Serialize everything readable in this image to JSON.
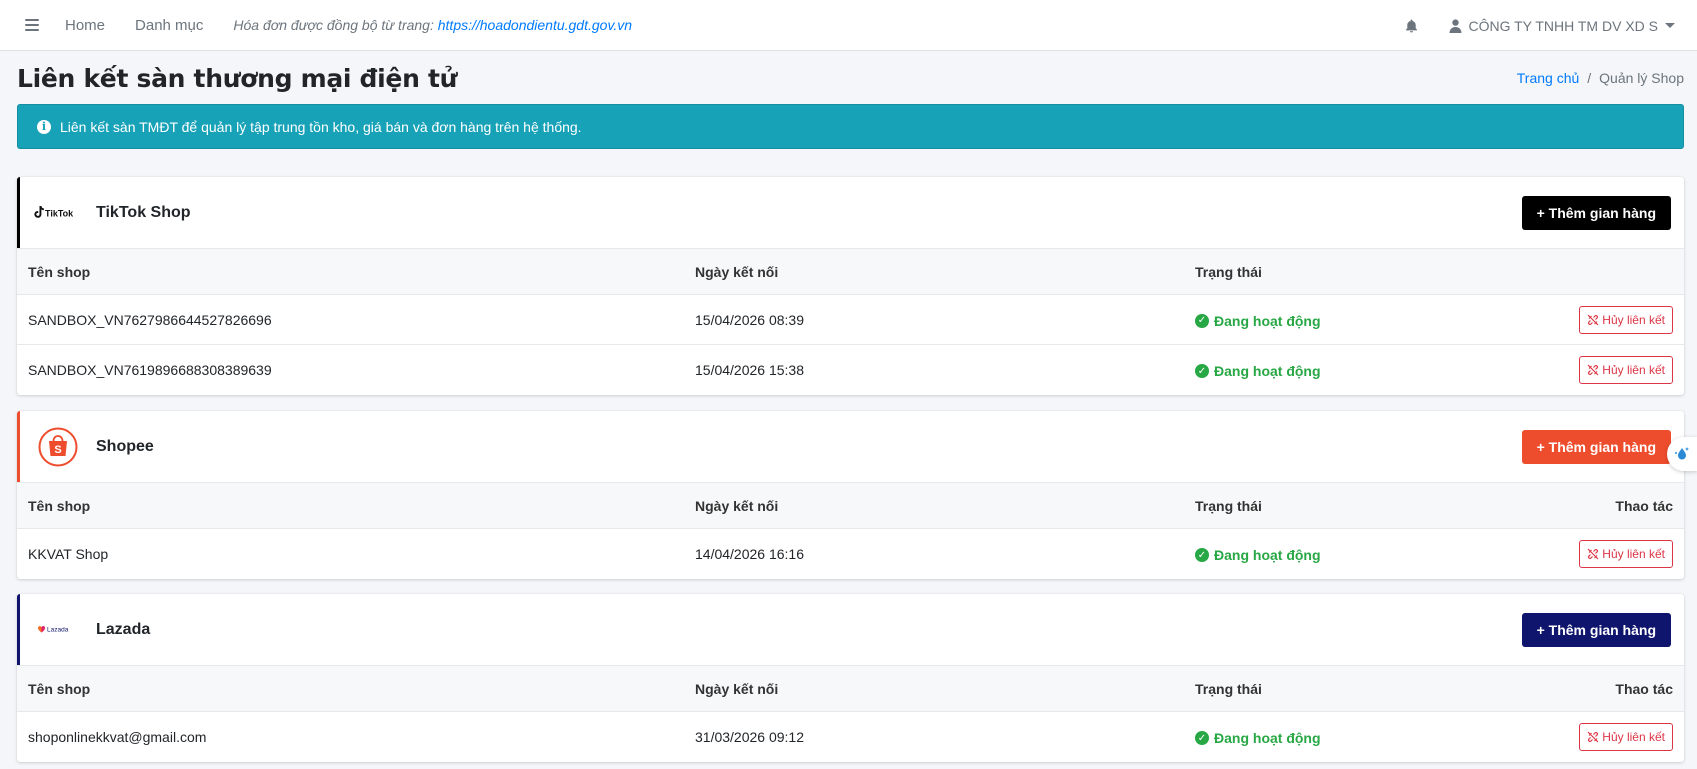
{
  "topbar": {
    "nav_home": "Home",
    "nav_category": "Danh mục",
    "sync_text": "Hóa đơn được đồng bộ từ trang:",
    "sync_link": "https://hoadondientu.gdt.gov.vn",
    "user_name": "CÔNG TY TNHH TM DV XD S"
  },
  "page": {
    "title": "Liên kết sàn thương mại điện tử",
    "breadcrumb_home": "Trang chủ",
    "breadcrumb_sep": "/",
    "breadcrumb_current": "Quản lý Shop"
  },
  "alert": {
    "text": "Liên kết sàn TMĐT để quản lý tập trung tồn kho, giá bán và đơn hàng trên hệ thống."
  },
  "columns": {
    "shop_name": "Tên shop",
    "connect_date": "Ngày kết nối",
    "status": "Trạng thái",
    "actions": "Thao tác"
  },
  "platforms": [
    {
      "name": "TikTok Shop",
      "logo_text": "TikTok",
      "accent": "#000000",
      "add_label": "+ Thêm gian hàng",
      "actions_header": "",
      "shops": [
        {
          "name": "SANDBOX_VN7627986644527826696",
          "date": "15/04/2026 08:39",
          "status": "Đang hoạt động",
          "action": "Hủy liên kết"
        },
        {
          "name": "SANDBOX_VN7619896688308389639",
          "date": "15/04/2026 15:38",
          "status": "Đang hoạt động",
          "action": "Hủy liên kết"
        }
      ]
    },
    {
      "name": "Shopee",
      "logo_text": "S",
      "accent": "#ee4d2d",
      "add_label": "+ Thêm gian hàng",
      "actions_header": "Thao tác",
      "shops": [
        {
          "name": "KKVAT Shop",
          "date": "14/04/2026 16:16",
          "status": "Đang hoạt động",
          "action": "Hủy liên kết"
        }
      ]
    },
    {
      "name": "Lazada",
      "logo_text": "Lazada",
      "accent": "#0f146d",
      "add_label": "+ Thêm gian hàng",
      "actions_header": "Thao tác",
      "shops": [
        {
          "name": "shoponlinekkvat@gmail.com",
          "date": "31/03/2026 09:12",
          "status": "Đang hoạt động",
          "action": "Hủy liên kết"
        }
      ]
    }
  ],
  "colors": {
    "info": "#17a2b8",
    "success": "#28a745",
    "danger": "#dc3545",
    "link": "#007bff"
  },
  "icons": {
    "menu": "hamburger-icon",
    "bell": "bell-icon",
    "user": "user-icon",
    "info": "info-circle-icon",
    "status": "check-circle-icon",
    "unlink": "unlink-icon"
  }
}
